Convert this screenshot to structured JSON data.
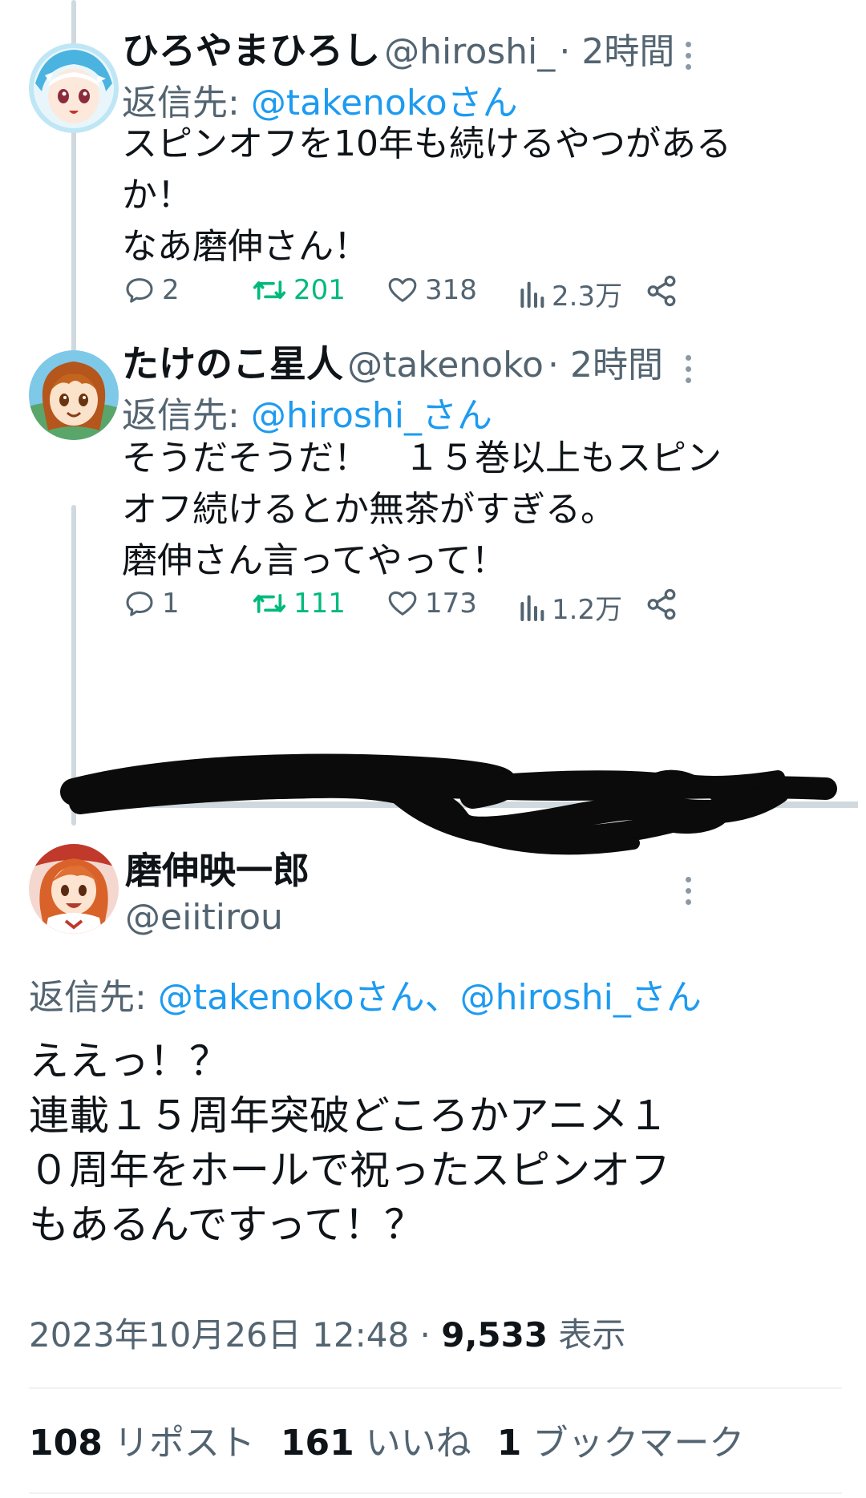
{
  "tweets": [
    {
      "name": "ひろやまひろし",
      "handle": "@hiroshi_",
      "time": "· 2時間",
      "reply_label": "返信先: ",
      "reply_to": "@takenokoさん",
      "text": "スピンオフを10年も続けるやつがある\nか！\nなあ磨伸さん！",
      "replies": "2",
      "reposts": "201",
      "likes": "318",
      "views": "2.3万"
    },
    {
      "name": "たけのこ星人",
      "handle": "@takenoko",
      "time": "· 2時間",
      "reply_label": "返信先: ",
      "reply_to": "@hiroshi_さん",
      "text": "そうだそうだ！　１５巻以上もスピン\nオフ続けるとか無茶がすぎる。\n磨伸さん言ってやって！",
      "replies": "1",
      "reposts": "111",
      "likes": "173",
      "views": "1.2万"
    }
  ],
  "main_tweet": {
    "name": "磨伸映一郎",
    "handle": "@eiitirou",
    "reply_label": "返信先: ",
    "reply_to": "@takenokoさん、@hiroshi_さん",
    "text": "ええっ！？\n連載１５周年突破どころかアニメ１\n０周年をホールで祝ったスピンオフ\nもあるんですって！？",
    "timestamp": "2023年10月26日 12:48 · ",
    "views_count": "9,533",
    "views_label": " 表示",
    "reposts_count": "108",
    "reposts_label": " リポスト",
    "likes_count": "161",
    "likes_label": " いいね",
    "bookmarks_count": "1",
    "bookmarks_label": " ブックマーク"
  },
  "colors": {
    "link": "#1d9bf0",
    "repost_active": "#00ba7c",
    "secondary_text": "#536471",
    "thread_line": "#cfd9de"
  }
}
